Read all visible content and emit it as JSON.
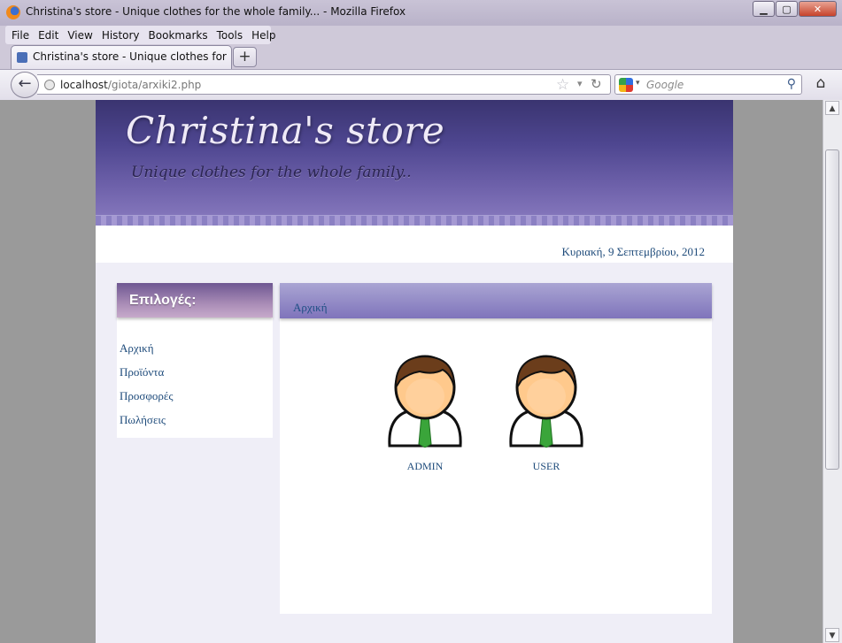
{
  "window": {
    "title": "Christina's store - Unique clothes for the whole family... - Mozilla Firefox",
    "min_label": "▁",
    "max_label": "▢",
    "close_label": "✕"
  },
  "menu": [
    "File",
    "Edit",
    "View",
    "History",
    "Bookmarks",
    "Tools",
    "Help"
  ],
  "tab": {
    "label": "Christina's store - Unique clothes for the...",
    "new_tab_label": "+"
  },
  "nav": {
    "back_label": "←",
    "url_host": "localhost",
    "url_path": "/giota/arxiki2.php",
    "search_placeholder": "Google",
    "star_icon": "☆",
    "reload_icon": "↻",
    "home_icon": "⌂",
    "search_icon": "⚲"
  },
  "site": {
    "title": "Christina's store",
    "subtitle": "Unique clothes for the whole family..",
    "date": "Κυριακή, 9 Σεπτεμβρίου, 2012"
  },
  "sidebar": {
    "heading": "Επιλογές:",
    "items": [
      "Αρχική",
      "Προϊόντα",
      "Προσφορές",
      "Πωλήσεις"
    ]
  },
  "main": {
    "breadcrumb": "Αρχική",
    "cards": [
      {
        "label": "ADMIN",
        "icon": "user-avatar-icon"
      },
      {
        "label": "USER",
        "icon": "user-avatar-icon"
      }
    ]
  },
  "colors": {
    "header_dark": "#3a3470",
    "header_light": "#8a7cc0",
    "link": "#1d4a7a",
    "tie": "#3aa53a"
  }
}
